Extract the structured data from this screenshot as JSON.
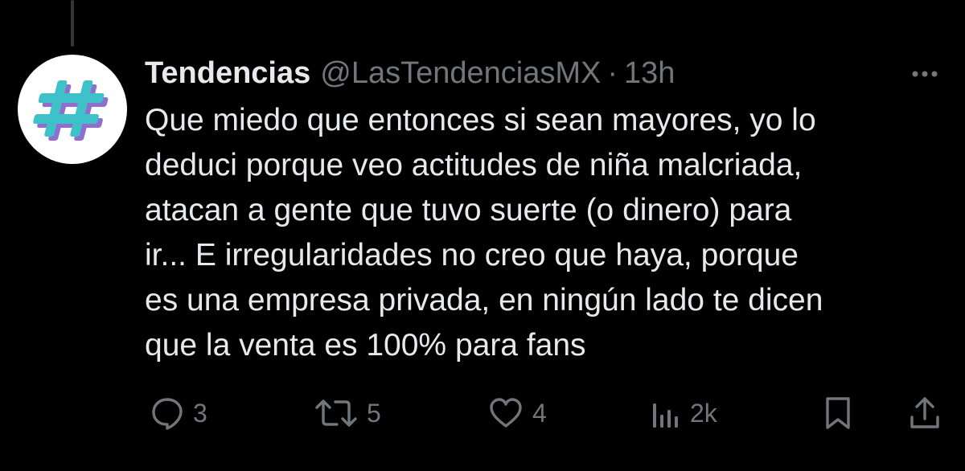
{
  "tweet": {
    "author": {
      "display_name": "Tendencias",
      "handle": "@LasTendenciasMX",
      "avatar_icon": "hashtag-icon",
      "avatar_colors": [
        "#3ec1c9",
        "#8e6fcf"
      ]
    },
    "separator": "·",
    "time": "13h",
    "text_lines": [
      "Que miedo que entonces si sean mayores, yo lo",
      "deduci porque veo actitudes de niña malcriada,",
      "atacan a gente que tuvo suerte (o dinero) para",
      "ir... E irregularidades no creo que haya, porque",
      "es una empresa privada, en ningún lado te dicen",
      "que la venta es 100% para fans"
    ],
    "actions": {
      "reply": {
        "icon": "reply-icon",
        "count": "3"
      },
      "retweet": {
        "icon": "retweet-icon",
        "count": "5"
      },
      "like": {
        "icon": "heart-icon",
        "count": "4"
      },
      "views": {
        "icon": "views-icon",
        "count": "2k"
      },
      "bookmark": {
        "icon": "bookmark-icon"
      },
      "share": {
        "icon": "share-icon"
      }
    }
  },
  "colors": {
    "background": "#000000",
    "primary_text": "#e7e9ea",
    "secondary_text": "#71767b",
    "thread_line": "#333639"
  }
}
